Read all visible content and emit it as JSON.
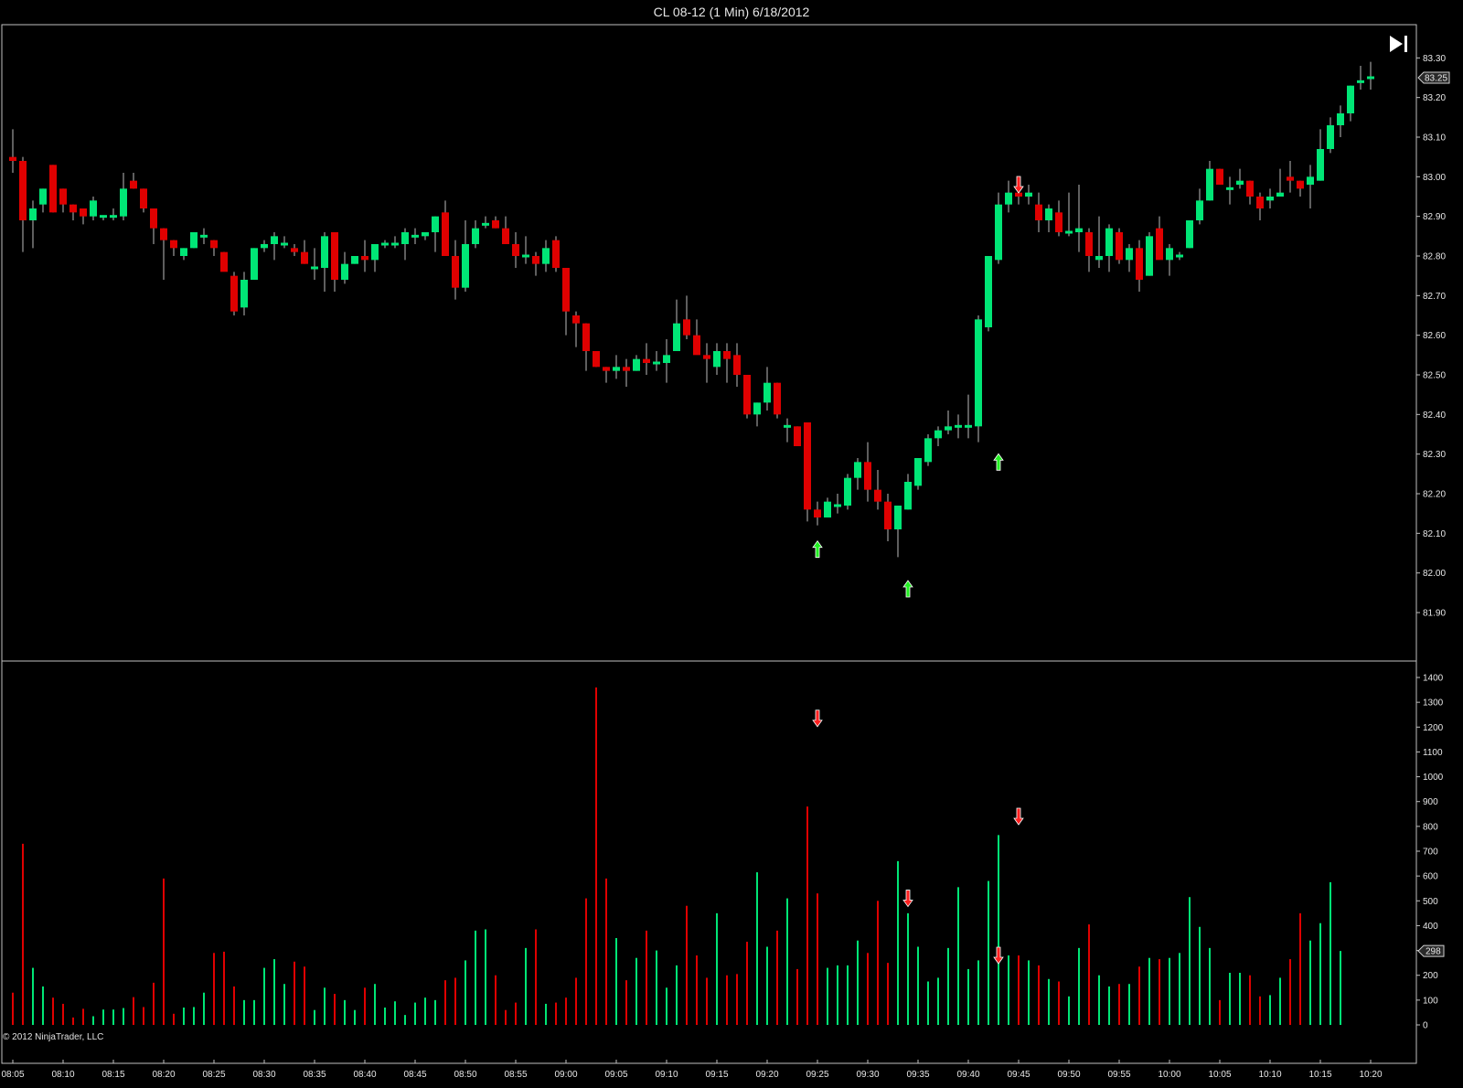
{
  "window": {
    "title": "CL 08-12 (1 Min)  6/18/2012"
  },
  "footer": {
    "copyright": "© 2012 NinjaTrader, LLC"
  },
  "colors": {
    "up": "#00e676",
    "down": "#e00000",
    "background": "#000000",
    "frame": "#bfbfbf",
    "arrow_up": "#22ee22",
    "arrow_down": "#ff2020"
  },
  "icons": {
    "goto_end": "skip-to-end-icon"
  },
  "chart_data": [
    {
      "type": "candlestick",
      "title": "CL 08-12 (1 Min)  6/18/2012",
      "grid": false,
      "y_ticks": [
        "83.30",
        "83.20",
        "83.10",
        "83.00",
        "82.90",
        "82.80",
        "82.70",
        "82.60",
        "82.50",
        "82.40",
        "82.30",
        "82.20",
        "82.10",
        "82.00",
        "81.90"
      ],
      "y_range": [
        81.85,
        83.37
      ],
      "last_price_label": "83.25",
      "x_ticks": [
        "08:05",
        "08:10",
        "08:15",
        "08:20",
        "08:25",
        "08:30",
        "08:35",
        "08:40",
        "08:45",
        "08:50",
        "08:55",
        "09:00",
        "09:05",
        "09:10",
        "09:15",
        "09:20",
        "09:25",
        "09:30",
        "09:35",
        "09:40",
        "09:45",
        "09:50",
        "09:55",
        "10:00",
        "10:05",
        "10:10",
        "10:15",
        "10:20"
      ],
      "bars_ohlc": [
        [
          83.05,
          83.12,
          83.01,
          83.04
        ],
        [
          83.04,
          83.05,
          82.81,
          82.89
        ],
        [
          82.89,
          82.94,
          82.82,
          82.92
        ],
        [
          82.93,
          82.97,
          82.91,
          82.97
        ],
        [
          83.03,
          83.03,
          82.91,
          82.91
        ],
        [
          82.97,
          82.97,
          82.91,
          82.93
        ],
        [
          82.93,
          82.93,
          82.89,
          82.91
        ],
        [
          82.92,
          82.92,
          82.88,
          82.9
        ],
        [
          82.9,
          82.95,
          82.89,
          82.94
        ],
        [
          82.9,
          82.9,
          82.89,
          82.9
        ],
        [
          82.9,
          82.92,
          82.89,
          82.9
        ],
        [
          82.9,
          83.01,
          82.89,
          82.97
        ],
        [
          82.99,
          83.01,
          82.97,
          82.97
        ],
        [
          82.97,
          82.97,
          82.91,
          82.92
        ],
        [
          82.92,
          82.92,
          82.83,
          82.87
        ],
        [
          82.87,
          82.87,
          82.74,
          82.84
        ],
        [
          82.84,
          82.84,
          82.8,
          82.82
        ],
        [
          82.8,
          82.82,
          82.79,
          82.82
        ],
        [
          82.82,
          82.86,
          82.82,
          82.86
        ],
        [
          82.85,
          82.87,
          82.83,
          82.85
        ],
        [
          82.84,
          82.84,
          82.8,
          82.82
        ],
        [
          82.81,
          82.81,
          82.77,
          82.76
        ],
        [
          82.75,
          82.76,
          82.65,
          82.66
        ],
        [
          82.67,
          82.76,
          82.65,
          82.74
        ],
        [
          82.74,
          82.82,
          82.74,
          82.82
        ],
        [
          82.82,
          82.84,
          82.81,
          82.83
        ],
        [
          82.83,
          82.86,
          82.79,
          82.85
        ],
        [
          82.83,
          82.85,
          82.82,
          82.83
        ],
        [
          82.82,
          82.83,
          82.8,
          82.81
        ],
        [
          82.81,
          82.84,
          82.78,
          82.78
        ],
        [
          82.77,
          82.82,
          82.74,
          82.77
        ],
        [
          82.77,
          82.86,
          82.71,
          82.85
        ],
        [
          82.86,
          82.86,
          82.71,
          82.74
        ],
        [
          82.74,
          82.81,
          82.73,
          82.78
        ],
        [
          82.78,
          82.8,
          82.78,
          82.8
        ],
        [
          82.8,
          82.84,
          82.76,
          82.79
        ],
        [
          82.79,
          82.83,
          82.76,
          82.83
        ],
        [
          82.83,
          82.84,
          82.82,
          82.83
        ],
        [
          82.83,
          82.85,
          82.82,
          82.83
        ],
        [
          82.83,
          82.87,
          82.79,
          82.86
        ],
        [
          82.85,
          82.87,
          82.83,
          82.85
        ],
        [
          82.85,
          82.86,
          82.84,
          82.86
        ],
        [
          82.86,
          82.9,
          82.81,
          82.9
        ],
        [
          82.91,
          82.94,
          82.82,
          82.8
        ],
        [
          82.8,
          82.84,
          82.69,
          82.72
        ],
        [
          82.72,
          82.89,
          82.71,
          82.83
        ],
        [
          82.83,
          82.89,
          82.82,
          82.87
        ],
        [
          82.88,
          82.9,
          82.87,
          82.88
        ],
        [
          82.89,
          82.9,
          82.87,
          82.87
        ],
        [
          82.87,
          82.9,
          82.85,
          82.83
        ],
        [
          82.83,
          82.86,
          82.77,
          82.8
        ],
        [
          82.8,
          82.85,
          82.78,
          82.8
        ],
        [
          82.8,
          82.81,
          82.75,
          82.78
        ],
        [
          82.78,
          82.84,
          82.76,
          82.82
        ],
        [
          82.84,
          82.85,
          82.76,
          82.77
        ],
        [
          82.77,
          82.77,
          82.6,
          82.66
        ],
        [
          82.65,
          82.66,
          82.57,
          82.63
        ],
        [
          82.63,
          82.63,
          82.51,
          82.56
        ],
        [
          82.56,
          82.56,
          82.52,
          82.52
        ],
        [
          82.52,
          82.52,
          82.48,
          82.51
        ],
        [
          82.51,
          82.55,
          82.49,
          82.52
        ],
        [
          82.52,
          82.54,
          82.47,
          82.51
        ],
        [
          82.51,
          82.55,
          82.51,
          82.54
        ],
        [
          82.54,
          82.58,
          82.5,
          82.53
        ],
        [
          82.53,
          82.56,
          82.51,
          82.53
        ],
        [
          82.53,
          82.59,
          82.48,
          82.55
        ],
        [
          82.56,
          82.69,
          82.56,
          82.63
        ],
        [
          82.64,
          82.7,
          82.59,
          82.6
        ],
        [
          82.6,
          82.64,
          82.56,
          82.55
        ],
        [
          82.55,
          82.58,
          82.48,
          82.54
        ],
        [
          82.52,
          82.58,
          82.5,
          82.56
        ],
        [
          82.56,
          82.58,
          82.48,
          82.54
        ],
        [
          82.55,
          82.58,
          82.47,
          82.5
        ],
        [
          82.5,
          82.5,
          82.39,
          82.4
        ],
        [
          82.4,
          82.43,
          82.37,
          82.43
        ],
        [
          82.43,
          82.52,
          82.41,
          82.48
        ],
        [
          82.48,
          82.48,
          82.39,
          82.4
        ],
        [
          82.37,
          82.39,
          82.33,
          82.37
        ],
        [
          82.37,
          82.37,
          82.32,
          82.32
        ],
        [
          82.38,
          82.38,
          82.13,
          82.16
        ],
        [
          82.16,
          82.18,
          82.12,
          82.14
        ],
        [
          82.14,
          82.19,
          82.14,
          82.18
        ],
        [
          82.17,
          82.2,
          82.15,
          82.17
        ],
        [
          82.17,
          82.25,
          82.16,
          82.24
        ],
        [
          82.24,
          82.29,
          82.21,
          82.28
        ],
        [
          82.28,
          82.33,
          82.18,
          82.21
        ],
        [
          82.21,
          82.26,
          82.16,
          82.18
        ],
        [
          82.18,
          82.2,
          82.08,
          82.11
        ],
        [
          82.11,
          82.13,
          82.04,
          82.17
        ],
        [
          82.16,
          82.25,
          82.16,
          82.23
        ],
        [
          82.22,
          82.29,
          82.21,
          82.29
        ],
        [
          82.28,
          82.35,
          82.27,
          82.34
        ],
        [
          82.34,
          82.37,
          82.32,
          82.36
        ],
        [
          82.36,
          82.41,
          82.35,
          82.37
        ],
        [
          82.37,
          82.4,
          82.34,
          82.37
        ],
        [
          82.37,
          82.45,
          82.34,
          82.37
        ],
        [
          82.37,
          82.65,
          82.33,
          82.64
        ],
        [
          82.62,
          82.8,
          82.61,
          82.8
        ],
        [
          82.79,
          82.96,
          82.78,
          82.93
        ],
        [
          82.93,
          82.99,
          82.91,
          82.96
        ],
        [
          82.96,
          82.99,
          82.93,
          82.95
        ],
        [
          82.95,
          82.98,
          82.93,
          82.96
        ],
        [
          82.93,
          82.96,
          82.86,
          82.89
        ],
        [
          82.89,
          82.93,
          82.86,
          82.92
        ],
        [
          82.91,
          82.94,
          82.85,
          82.86
        ],
        [
          82.86,
          82.96,
          82.85,
          82.86
        ],
        [
          82.86,
          82.98,
          82.81,
          82.87
        ],
        [
          82.86,
          82.87,
          82.76,
          82.8
        ],
        [
          82.79,
          82.9,
          82.77,
          82.8
        ],
        [
          82.8,
          82.88,
          82.76,
          82.87
        ],
        [
          82.86,
          82.87,
          82.78,
          82.79
        ],
        [
          82.79,
          82.83,
          82.76,
          82.82
        ],
        [
          82.82,
          82.84,
          82.71,
          82.74
        ],
        [
          82.75,
          82.86,
          82.75,
          82.85
        ],
        [
          82.87,
          82.9,
          82.81,
          82.79
        ],
        [
          82.79,
          82.83,
          82.75,
          82.82
        ],
        [
          82.8,
          82.81,
          82.79,
          82.8
        ],
        [
          82.82,
          82.89,
          82.82,
          82.89
        ],
        [
          82.89,
          82.97,
          82.88,
          82.94
        ],
        [
          82.94,
          83.04,
          82.94,
          83.02
        ],
        [
          83.02,
          83.02,
          82.98,
          82.98
        ],
        [
          82.97,
          83.0,
          82.93,
          82.97
        ],
        [
          82.98,
          83.02,
          82.97,
          82.99
        ],
        [
          82.99,
          82.99,
          82.93,
          82.95
        ],
        [
          82.95,
          82.96,
          82.89,
          82.92
        ],
        [
          82.94,
          82.97,
          82.92,
          82.95
        ],
        [
          82.95,
          83.02,
          82.95,
          82.96
        ],
        [
          83.0,
          83.04,
          82.96,
          82.99
        ],
        [
          82.99,
          82.99,
          82.95,
          82.97
        ],
        [
          82.98,
          83.03,
          82.92,
          83.0
        ],
        [
          82.99,
          83.12,
          82.99,
          83.07
        ],
        [
          83.07,
          83.15,
          83.06,
          83.13
        ],
        [
          83.13,
          83.18,
          83.1,
          83.16
        ],
        [
          83.16,
          83.23,
          83.14,
          83.23
        ],
        [
          83.24,
          83.28,
          83.22,
          83.24
        ],
        [
          83.25,
          83.29,
          83.22,
          83.25
        ]
      ],
      "signal_arrows": [
        {
          "bar": 80,
          "direction": "up",
          "price": 82.06
        },
        {
          "bar": 89,
          "direction": "up",
          "price": 81.96
        },
        {
          "bar": 98,
          "direction": "up",
          "price": 82.28
        },
        {
          "bar": 100,
          "direction": "down",
          "price": 82.98
        }
      ]
    },
    {
      "type": "volume_bar",
      "y_ticks": [
        "1400",
        "1300",
        "1200",
        "1100",
        "1000",
        "900",
        "800",
        "700",
        "600",
        "500",
        "400",
        "300",
        "200",
        "100",
        "0"
      ],
      "y_range": [
        0,
        1460
      ],
      "last_value_label": "298",
      "values": [
        130,
        730,
        230,
        155,
        110,
        85,
        30,
        65,
        35,
        62,
        62,
        68,
        112,
        72,
        170,
        590,
        45,
        70,
        72,
        130,
        290,
        295,
        155,
        100,
        100,
        230,
        265,
        165,
        255,
        235,
        60,
        150,
        125,
        100,
        60,
        150,
        165,
        70,
        95,
        40,
        90,
        110,
        100,
        180,
        190,
        260,
        380,
        385,
        200,
        60,
        90,
        310,
        385,
        85,
        90,
        110,
        190,
        510,
        1360,
        590,
        350,
        180,
        270,
        380,
        300,
        150,
        240,
        480,
        280,
        190,
        450,
        200,
        205,
        335,
        615,
        315,
        380,
        510,
        225,
        880,
        530,
        230,
        240,
        240,
        340,
        290,
        500,
        250,
        660,
        450,
        315,
        175,
        190,
        310,
        555,
        225,
        260,
        580,
        765,
        280,
        280,
        260,
        240,
        185,
        175,
        115,
        310,
        405,
        200,
        155,
        165,
        165,
        235,
        270,
        265,
        270,
        290,
        515,
        395,
        310,
        100,
        210,
        210,
        200,
        115,
        120,
        190,
        265,
        450,
        340,
        410,
        575,
        298
      ],
      "signal_arrows": [
        {
          "bar": 80,
          "direction": "down",
          "value": 1235
        },
        {
          "bar": 89,
          "direction": "down",
          "value": 510
        },
        {
          "bar": 98,
          "direction": "down",
          "value": 280
        },
        {
          "bar": 100,
          "direction": "down",
          "value": 840
        }
      ]
    }
  ]
}
